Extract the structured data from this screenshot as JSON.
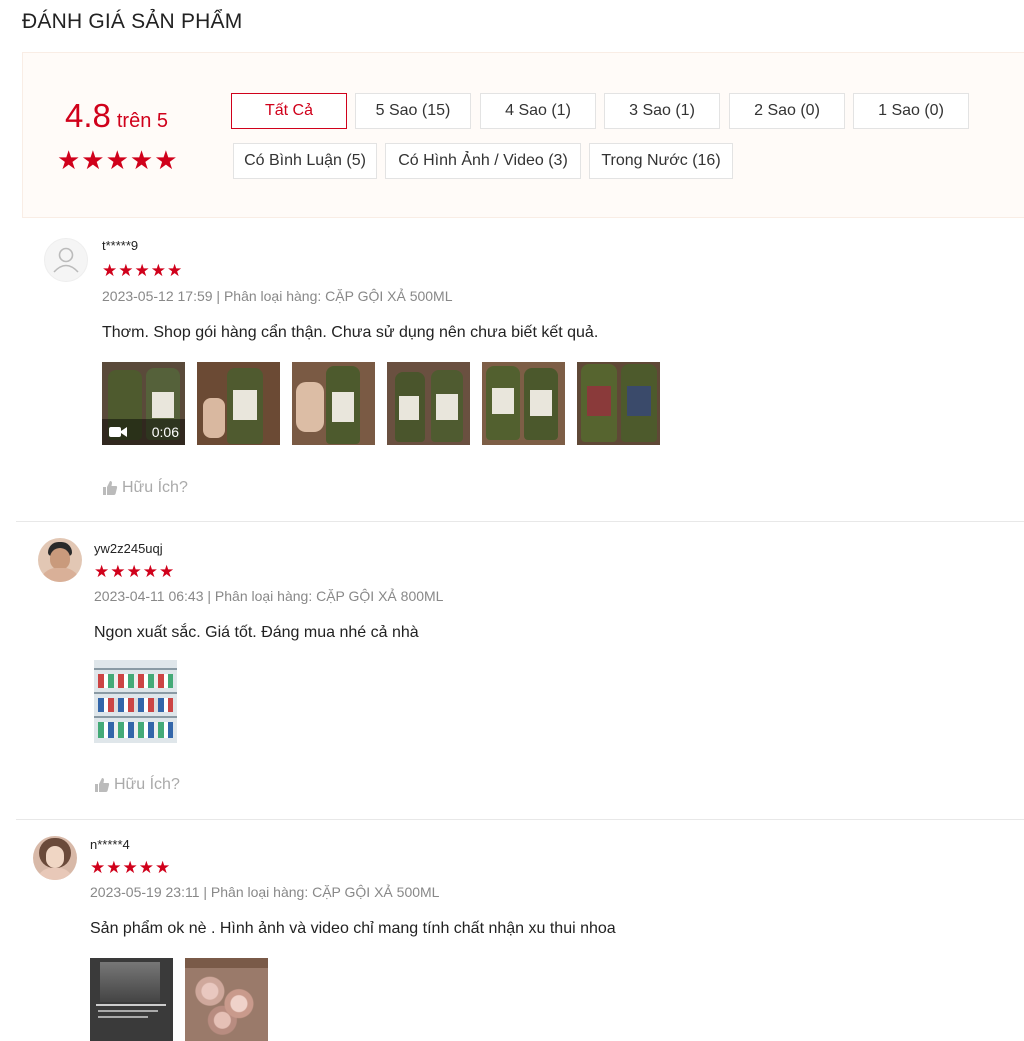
{
  "page": {
    "title": "ĐÁNH GIÁ SẢN PHẨM"
  },
  "summary": {
    "score": "4.8",
    "out_of": "trên 5",
    "stars": "★★★★★",
    "filters": [
      {
        "label": "Tất Cả",
        "active": true
      },
      {
        "label": "5 Sao (15)"
      },
      {
        "label": "4 Sao (1)"
      },
      {
        "label": "3 Sao (1)"
      },
      {
        "label": "2 Sao (0)"
      },
      {
        "label": "1 Sao (0)"
      },
      {
        "label": "Có Bình Luận (5)"
      },
      {
        "label": "Có Hình Ảnh / Video (3)"
      },
      {
        "label": "Trong Nước (16)"
      }
    ]
  },
  "reviews": [
    {
      "username": "t*****9",
      "stars": "★★★★★",
      "meta": "2023-05-12 17:59 | Phân loại hàng: CẶP GỘI XẢ 500ML",
      "comment": "Thơm. Shop gói hàng cẩn thận. Chưa sử dụng nên chưa biết kết quả.",
      "video_duration": "0:06",
      "helpful": "Hữu Ích?"
    },
    {
      "username": "yw2z245uqj",
      "stars": "★★★★★",
      "meta": "2023-04-11 06:43 | Phân loại hàng: CẶP GỘI XẢ 800ML",
      "comment": "Ngon xuất sắc. Giá tốt. Đáng mua nhé cả nhà",
      "helpful": "Hữu Ích?"
    },
    {
      "username": "n*****4",
      "stars": "★★★★★",
      "meta": "2023-05-19 23:11 | Phân loại hàng: CẶP GỘI XẢ 500ML",
      "comment": "Sản phẩm ok nè . Hình ảnh và video chỉ mang tính chất nhận xu thui nhoa"
    }
  ],
  "colors": {
    "accent": "#d0011b",
    "summary_bg": "#fffbf8",
    "muted": "#888888"
  },
  "icons": [
    "user-silhouette-icon",
    "video-camera-icon",
    "thumbs-up-icon"
  ]
}
